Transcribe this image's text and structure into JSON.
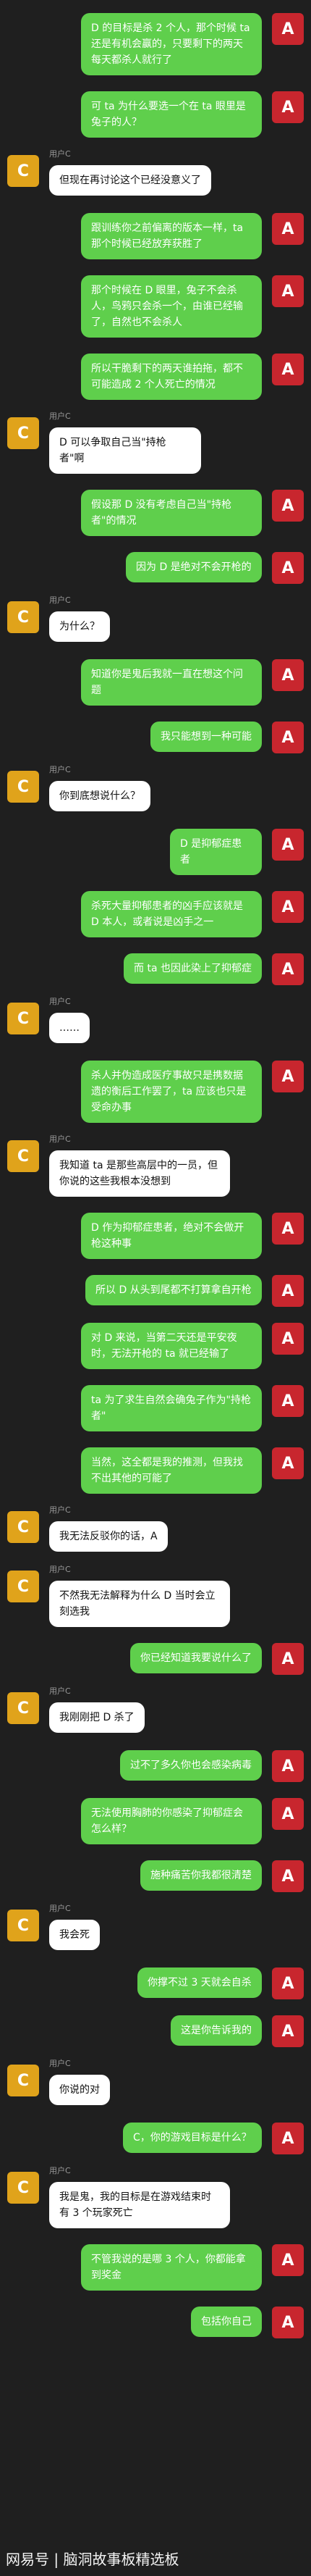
{
  "username": "用户C",
  "avatars": {
    "a": "A",
    "c": "C"
  },
  "messages": [
    {
      "sender": "A",
      "text": "D 的目标是杀 2 个人，那个时候 ta 还是有机会赢的，只要剩下的两天每天都杀人就行了"
    },
    {
      "sender": "A",
      "text": "可 ta 为什么要选一个在 ta 眼里是兔子的人？"
    },
    {
      "sender": "C",
      "text": "但现在再讨论这个已经没意义了"
    },
    {
      "sender": "A",
      "text": "跟训练你之前偏离的版本一样，ta 那个时候已经放弃获胜了"
    },
    {
      "sender": "A",
      "text": "那个时候在 D 眼里，兔子不会杀人，鸟鸦只会杀一个，由谁已经输了，自然也不会杀人"
    },
    {
      "sender": "A",
      "text": "所以干脆剩下的两天谁拍拖，都不可能造成 2 个人死亡的情况"
    },
    {
      "sender": "C",
      "text": "D 可以争取自己当\"持枪者\"啊"
    },
    {
      "sender": "A",
      "text": "假设那 D 没有考虑自己当\"持枪者\"的情况"
    },
    {
      "sender": "A",
      "text": "因为 D 是绝对不会开枪的"
    },
    {
      "sender": "C",
      "text": "为什么？"
    },
    {
      "sender": "A",
      "text": "知道你是鬼后我就一直在想这个问题"
    },
    {
      "sender": "A",
      "text": "我只能想到一种可能"
    },
    {
      "sender": "C",
      "text": "你到底想说什么？"
    },
    {
      "sender": "A",
      "text": "D 是抑郁症患者"
    },
    {
      "sender": "A",
      "text": "杀死大量抑郁患者的凶手应该就是 D 本人，或者说是凶手之一"
    },
    {
      "sender": "A",
      "text": "而 ta 也因此染上了抑郁症"
    },
    {
      "sender": "C",
      "text": "……"
    },
    {
      "sender": "A",
      "text": "杀人并伪造成医疗事故只是携数据遗的衡后工作罢了，ta 应该也只是受命办事"
    },
    {
      "sender": "C",
      "text": "我知道 ta 是那些高层中的一员，但你说的这些我根本没想到"
    },
    {
      "sender": "A",
      "text": "D 作为抑郁症患者，绝对不会做开枪这种事"
    },
    {
      "sender": "A",
      "text": "所以 D 从头到尾都不打算拿自开枪"
    },
    {
      "sender": "A",
      "text": "对 D 来说，当第二天还是平安夜时，无法开枪的 ta 就已经输了"
    },
    {
      "sender": "A",
      "text": "ta 为了求生自然会确兔子作为\"持枪者\""
    },
    {
      "sender": "A",
      "text": "当然，这全都是我的推测，但我找不出其他的可能了"
    },
    {
      "sender": "C",
      "text": "我无法反驳你的话，A"
    },
    {
      "sender": "C",
      "text": "不然我无法解释为什么 D 当时会立刻选我"
    },
    {
      "sender": "A",
      "text": "你已经知道我要说什么了"
    },
    {
      "sender": "C",
      "text": "我刚刚把 D 杀了"
    },
    {
      "sender": "A",
      "text": "过不了多久你也会感染病毒"
    },
    {
      "sender": "A",
      "text": "无法使用胸肺的你感染了抑郁症会怎么样？"
    },
    {
      "sender": "A",
      "text": "施种痛苦你我都很清楚"
    },
    {
      "sender": "C",
      "text": "我会死"
    },
    {
      "sender": "A",
      "text": "你撑不过 3 天就会自杀"
    },
    {
      "sender": "A",
      "text": "这是你告诉我的"
    },
    {
      "sender": "C",
      "text": "你说的对"
    },
    {
      "sender": "A",
      "text": "C，你的游戏目标是什么？"
    },
    {
      "sender": "C",
      "text": "我是鬼，我的目标是在游戏结束时有 3 个玩家死亡"
    },
    {
      "sender": "A",
      "text": "不管我说的是哪 3 个人，你都能拿到奖金"
    },
    {
      "sender": "A",
      "text": "包括你自己"
    }
  ],
  "footer": {
    "watermark": "网易号 | 脑洞故事板精选板"
  }
}
